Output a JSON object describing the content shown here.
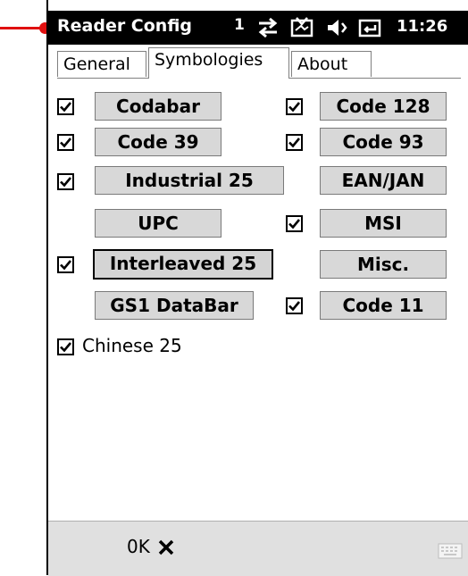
{
  "titlebar": {
    "app_title": "Reader Config",
    "signal_indicator": "1",
    "time": "11:26"
  },
  "tabs": [
    {
      "label": "General",
      "active": false
    },
    {
      "label": "Symbologies",
      "active": true
    },
    {
      "label": "About",
      "active": false
    }
  ],
  "symbologies": {
    "left": [
      {
        "label": "Codabar",
        "checked": true
      },
      {
        "label": "Code 39",
        "checked": true
      },
      {
        "label": "Industrial 25",
        "checked": true
      },
      {
        "label": "UPC",
        "checked": false
      },
      {
        "label": "Interleaved 25",
        "checked": true
      },
      {
        "label": "GS1 DataBar",
        "checked": false
      }
    ],
    "right": [
      {
        "label": "Code 128",
        "checked": true
      },
      {
        "label": "Code 93",
        "checked": true
      },
      {
        "label": "EAN/JAN",
        "checked": false
      },
      {
        "label": "MSI",
        "checked": true
      },
      {
        "label": "Misc.",
        "checked": false
      },
      {
        "label": "Code 11",
        "checked": true
      }
    ],
    "chinese": {
      "label": "Chinese 25",
      "checked": true
    }
  },
  "bottombar": {
    "ok_label": "0K"
  },
  "icons": {
    "signal": "sync-arrows-icon",
    "network": "connection-icon",
    "volume": "speaker-icon",
    "battery": "battery-icon",
    "close": "close-x-icon",
    "keyboard": "keyboard-icon"
  },
  "colors": {
    "pointer": "#e01010",
    "titlebar_bg": "#000000",
    "button_bg": "#d8d8d8",
    "bottombar_bg": "#e0e0e0"
  }
}
